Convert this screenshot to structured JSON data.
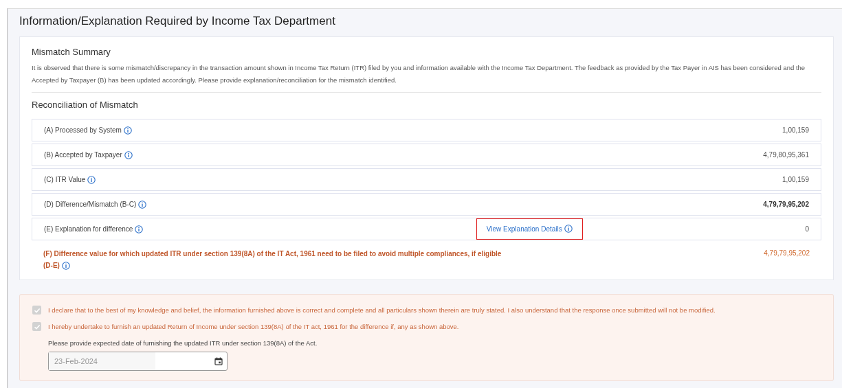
{
  "page": {
    "title": "Information/Explanation Required by Income Tax Department"
  },
  "summary": {
    "heading": "Mismatch Summary",
    "text": "It is observed that there is some mismatch/discrepancy in the transaction amount shown in Income Tax Return (ITR) filed by you and information available with the Income Tax Department. The feedback as provided by the Tax Payer in AIS has been considered and the Accepted by Taxpayer (B) has been updated accordingly. Please provide explanation/reconciliation for the mismatch identified."
  },
  "reconciliation": {
    "heading": "Reconciliation of Mismatch",
    "rows": [
      {
        "kind": "row",
        "label": "(A) Processed by System",
        "value": "1,00,159",
        "bold": false
      },
      {
        "kind": "row",
        "label": "(B) Accepted by Taxpayer",
        "value": "4,79,80,95,361",
        "bold": false
      },
      {
        "kind": "row",
        "label": "(C) ITR Value",
        "value": "1,00,159",
        "bold": false
      },
      {
        "kind": "row",
        "label": "(D) Difference/Mismatch (B-C)",
        "value": "4,79,79,95,202",
        "bold": true
      },
      {
        "kind": "row",
        "label": "(E) Explanation for difference",
        "value": "0",
        "bold": false,
        "link": "View Explanation Details"
      },
      {
        "kind": "highlight",
        "label": "(F) Difference value for which updated ITR under section 139(8A) of the IT Act, 1961 need to be filed to avoid multiple compliances, if eligible",
        "label_line2": "(D-E)",
        "value": "4,79,79,95,202"
      }
    ]
  },
  "declaration": {
    "checks": [
      {
        "text": "I declare that to the best of my knowledge and belief, the information furnished above is correct and complete and all particulars shown therein are truly stated. I also understand that the response once submitted will not be modified.",
        "checked": true,
        "disabled": true
      },
      {
        "text": "I hereby undertake to furnish an updated Return of Income under section 139(8A) of the IT act, 1961 for the difference if, any as shown above.",
        "checked": true,
        "disabled": true
      }
    ],
    "date_label": "Please provide expected date of furnishing the updated ITR under section 139(8A) of the Act.",
    "date_value": "23-Feb-2024"
  }
}
